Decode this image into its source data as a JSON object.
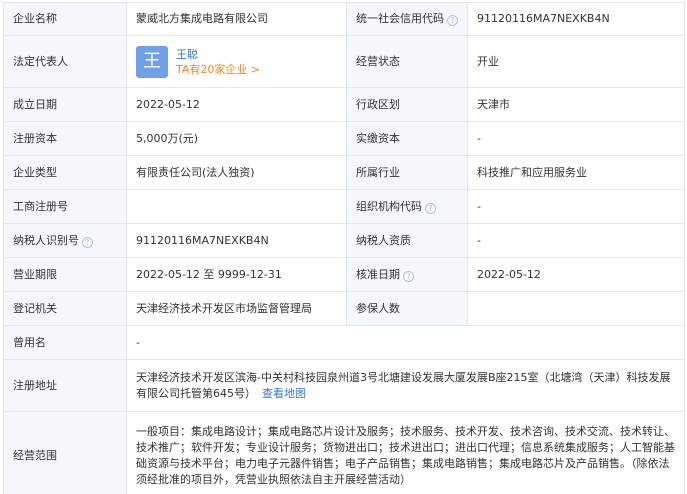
{
  "rows": {
    "company_name": {
      "label": "企业名称",
      "value": "蒙威北方集成电路有限公司"
    },
    "credit_code": {
      "label": "统一社会信用代码",
      "value": "91120116MA7NEXKB4N"
    },
    "legal_rep": {
      "label": "法定代表人",
      "avatar_char": "王",
      "name": "王聪",
      "company_count": "TA有20家企业 >"
    },
    "status": {
      "label": "经营状态",
      "value": "开业"
    },
    "established": {
      "label": "成立日期",
      "value": "2022-05-12"
    },
    "region": {
      "label": "行政区划",
      "value": "天津市"
    },
    "reg_capital": {
      "label": "注册资本",
      "value": "5,000万(元)"
    },
    "paid_capital": {
      "label": "实缴资本",
      "value": "-"
    },
    "company_type": {
      "label": "企业类型",
      "value": "有限责任公司(法人独资)"
    },
    "industry": {
      "label": "所属行业",
      "value": "科技推广和应用服务业"
    },
    "biz_reg_no": {
      "label": "工商注册号",
      "value": ""
    },
    "org_code": {
      "label": "组织机构代码",
      "value": "-"
    },
    "taxpayer_id": {
      "label": "纳税人识别号",
      "value": "91120116MA7NEXKB4N"
    },
    "taxpayer_qual": {
      "label": "纳税人资质",
      "value": "-"
    },
    "biz_term": {
      "label": "营业期限",
      "value": "2022-05-12 至 9999-12-31"
    },
    "approval_date": {
      "label": "核准日期",
      "value": "2022-05-12"
    },
    "reg_authority": {
      "label": "登记机关",
      "value": "天津经济技术开发区市场监督管理局"
    },
    "insured": {
      "label": "参保人数",
      "value": ""
    },
    "former_name": {
      "label": "曾用名",
      "value": "-"
    },
    "address": {
      "label": "注册地址",
      "value": "天津经济技术开发区滨海-中关村科技园泉州道3号北塘建设发展大厦发展B座215室（北塘湾（天津）科技发展有限公司托管第645号）",
      "map_link": "查看地图"
    },
    "biz_scope": {
      "label": "经营范围",
      "value": "一般项目：集成电路设计；集成电路芯片设计及服务；技术服务、技术开发、技术咨询、技术交流、技术转让、技术推广；软件开发；专业设计服务；货物进出口；技术进出口；进出口代理；信息系统集成服务；人工智能基础资源与技术平台；电力电子元器件销售；电子产品销售；集成电路销售；集成电路芯片及产品销售。（除依法须经批准的项目外，凭营业执照依法自主开展经营活动）"
    }
  },
  "icons": {
    "help": "help-circle-icon",
    "help_glyph": "?"
  }
}
